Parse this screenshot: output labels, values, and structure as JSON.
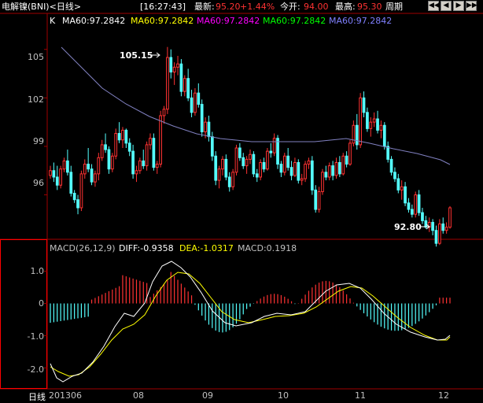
{
  "header": {
    "title": "电解镍(BNI)<日线>",
    "time": "[16:27:43]",
    "latest_label": "最新:",
    "latest_value": "95.20",
    "change": "+1.44%",
    "open_label": "今开:",
    "open_value": "94.00",
    "high_label": "最高:",
    "high_value": "95.30",
    "period_label": "周期"
  },
  "main_panel": {
    "k_label": "K",
    "ma_entries": [
      {
        "text": "MA60:97.2842",
        "color": "#ffffff"
      },
      {
        "text": "MA60:97.2842",
        "color": "#ffff00"
      },
      {
        "text": "MA60:97.2842",
        "color": "#ff00ff"
      },
      {
        "text": "MA60:97.2842",
        "color": "#00ff00"
      },
      {
        "text": "MA60:97.2842",
        "color": "#8080ff"
      }
    ],
    "y_ticks": [
      "105",
      "102",
      "99",
      "96"
    ],
    "annot_high": "105.15",
    "annot_low": "92.80"
  },
  "macd_panel": {
    "title": "MACD(26,12,9)",
    "diff": "DIFF:-0.9358",
    "dea": "DEA:-1.0317",
    "macd": "MACD:0.1918",
    "y_ticks": [
      "1.0",
      "0",
      "-1.0",
      "-2.0"
    ]
  },
  "x_axis": {
    "period": "日线",
    "labels": [
      "201306",
      "08",
      "09",
      "10",
      "11",
      "12"
    ]
  },
  "colors": {
    "up": "#ff3232",
    "down": "#54ffff",
    "ma": "#8080c0",
    "diff": "#ffffff",
    "dea": "#ffff00",
    "frame": "#a00000"
  },
  "chart_data": {
    "type": "candlestick",
    "ylim": [
      93.3,
      106.4
    ],
    "candles": [
      [
        97.2,
        97.8,
        97.0,
        97.5
      ],
      [
        97.5,
        98.0,
        96.8,
        97.1
      ],
      [
        97.1,
        97.8,
        96.3,
        96.6
      ],
      [
        96.6,
        97.8,
        96.4,
        97.6
      ],
      [
        97.6,
        98.3,
        97.4,
        98.1
      ],
      [
        98.1,
        98.8,
        97.2,
        97.4
      ],
      [
        97.4,
        97.8,
        95.9,
        96.1
      ],
      [
        96.1,
        96.3,
        95.5,
        95.7
      ],
      [
        95.7,
        96.0,
        94.8,
        95.2
      ],
      [
        95.2,
        97.5,
        95.0,
        97.3
      ],
      [
        97.3,
        98.2,
        97.0,
        97.9
      ],
      [
        97.9,
        98.9,
        97.4,
        97.6
      ],
      [
        97.6,
        97.9,
        96.6,
        96.8
      ],
      [
        96.8,
        97.5,
        96.5,
        97.3
      ],
      [
        97.3,
        98.6,
        96.9,
        98.3
      ],
      [
        98.3,
        99.4,
        98.1,
        99.1
      ],
      [
        99.1,
        99.8,
        98.6,
        98.8
      ],
      [
        98.8,
        99.0,
        97.3,
        97.6
      ],
      [
        97.6,
        98.6,
        97.4,
        98.4
      ],
      [
        98.4,
        100.1,
        98.2,
        99.8
      ],
      [
        99.8,
        100.5,
        99.2,
        99.4
      ],
      [
        99.4,
        100.2,
        98.9,
        100.0
      ],
      [
        100.0,
        100.1,
        98.9,
        99.2
      ],
      [
        99.2,
        99.5,
        98.4,
        98.7
      ],
      [
        98.7,
        99.1,
        97.0,
        97.3
      ],
      [
        97.3,
        97.8,
        96.8,
        97.5
      ],
      [
        97.5,
        98.3,
        97.3,
        98.1
      ],
      [
        98.1,
        98.8,
        97.6,
        97.8
      ],
      [
        97.8,
        99.3,
        97.5,
        99.1
      ],
      [
        99.1,
        99.8,
        98.8,
        99.5
      ],
      [
        99.5,
        99.8,
        97.5,
        97.7
      ],
      [
        97.7,
        98.1,
        97.3,
        97.9
      ],
      [
        97.9,
        101.2,
        97.7,
        100.9
      ],
      [
        100.9,
        101.5,
        100.4,
        101.3
      ],
      [
        101.3,
        105.15,
        101.0,
        104.5
      ],
      [
        104.5,
        105.0,
        103.2,
        103.6
      ],
      [
        103.6,
        104.2,
        102.8,
        103.9
      ],
      [
        103.9,
        104.6,
        103.4,
        104.1
      ],
      [
        104.1,
        104.4,
        102.1,
        102.4
      ],
      [
        102.4,
        103.4,
        102.1,
        103.2
      ],
      [
        103.2,
        103.8,
        101.8,
        102.0
      ],
      [
        102.0,
        102.5,
        100.8,
        101.1
      ],
      [
        101.1,
        102.6,
        100.9,
        102.3
      ],
      [
        102.3,
        102.9,
        101.4,
        101.6
      ],
      [
        101.6,
        101.9,
        99.6,
        99.9
      ],
      [
        99.9,
        100.8,
        99.5,
        100.5
      ],
      [
        100.5,
        100.9,
        99.3,
        99.6
      ],
      [
        99.6,
        99.9,
        98.1,
        98.4
      ],
      [
        98.4,
        98.7,
        96.6,
        96.9
      ],
      [
        96.9,
        97.8,
        96.4,
        97.6
      ],
      [
        97.6,
        98.4,
        97.2,
        98.2
      ],
      [
        98.2,
        98.5,
        96.9,
        97.1
      ],
      [
        97.1,
        97.4,
        96.2,
        96.5
      ],
      [
        96.5,
        97.6,
        96.3,
        97.4
      ],
      [
        97.4,
        99.1,
        97.2,
        98.9
      ],
      [
        98.9,
        99.2,
        98.1,
        98.3
      ],
      [
        98.3,
        98.6,
        97.6,
        97.8
      ],
      [
        97.8,
        98.4,
        97.3,
        98.2
      ],
      [
        98.2,
        98.8,
        97.9,
        98.5
      ],
      [
        98.5,
        98.7,
        97.1,
        97.3
      ],
      [
        97.3,
        97.6,
        96.8,
        97.1
      ],
      [
        97.1,
        98.2,
        96.9,
        98.0
      ],
      [
        98.0,
        98.3,
        97.4,
        97.6
      ],
      [
        97.6,
        98.9,
        97.5,
        98.7
      ],
      [
        98.7,
        99.2,
        98.3,
        98.6
      ],
      [
        98.6,
        99.8,
        98.4,
        99.5
      ],
      [
        99.5,
        99.7,
        97.6,
        97.9
      ],
      [
        97.9,
        98.1,
        97.1,
        97.4
      ],
      [
        97.4,
        98.6,
        97.2,
        98.4
      ],
      [
        98.4,
        98.9,
        97.5,
        97.7
      ],
      [
        97.7,
        98.1,
        96.9,
        97.2
      ],
      [
        97.2,
        98.3,
        97.1,
        98.0
      ],
      [
        98.0,
        98.2,
        96.7,
        96.9
      ],
      [
        96.9,
        97.3,
        96.6,
        97.0
      ],
      [
        97.0,
        98.1,
        96.8,
        97.9
      ],
      [
        97.9,
        98.3,
        97.6,
        98.1
      ],
      [
        98.1,
        98.4,
        96.0,
        96.3
      ],
      [
        96.3,
        96.6,
        94.9,
        95.1
      ],
      [
        95.1,
        96.5,
        94.9,
        96.2
      ],
      [
        96.2,
        97.6,
        96.0,
        97.4
      ],
      [
        97.4,
        97.8,
        96.9,
        97.1
      ],
      [
        97.1,
        98.0,
        96.9,
        97.8
      ],
      [
        97.8,
        98.1,
        96.9,
        97.2
      ],
      [
        97.2,
        98.3,
        97.0,
        98.0
      ],
      [
        98.0,
        98.4,
        97.1,
        97.3
      ],
      [
        97.3,
        98.6,
        97.2,
        98.4
      ],
      [
        98.4,
        98.7,
        97.7,
        97.9
      ],
      [
        97.9,
        99.4,
        97.8,
        99.2
      ],
      [
        99.2,
        100.6,
        99.0,
        100.3
      ],
      [
        100.3,
        101.0,
        98.8,
        99.1
      ],
      [
        99.1,
        102.3,
        98.9,
        102.0
      ],
      [
        102.0,
        102.4,
        100.8,
        101.1
      ],
      [
        101.1,
        101.4,
        99.9,
        100.1
      ],
      [
        100.1,
        100.8,
        99.6,
        100.5
      ],
      [
        100.5,
        101.1,
        100.2,
        100.7
      ],
      [
        100.7,
        101.2,
        99.8,
        100.0
      ],
      [
        100.0,
        100.6,
        99.5,
        100.3
      ],
      [
        100.3,
        100.5,
        98.8,
        99.0
      ],
      [
        99.0,
        99.3,
        98.0,
        98.2
      ],
      [
        98.2,
        98.4,
        97.2,
        97.4
      ],
      [
        97.4,
        97.7,
        96.8,
        97.0
      ],
      [
        97.0,
        97.3,
        96.1,
        96.3
      ],
      [
        96.3,
        96.9,
        95.7,
        96.5
      ],
      [
        96.5,
        96.8,
        95.3,
        95.5
      ],
      [
        95.5,
        95.8,
        94.9,
        95.1
      ],
      [
        95.1,
        95.4,
        94.6,
        94.8
      ],
      [
        94.8,
        96.2,
        94.6,
        96.0
      ],
      [
        96.0,
        96.3,
        94.7,
        94.9
      ],
      [
        94.9,
        95.2,
        94.2,
        94.4
      ],
      [
        94.4,
        94.7,
        93.9,
        94.0
      ],
      [
        94.0,
        94.6,
        93.7,
        94.3
      ],
      [
        94.3,
        94.5,
        93.5,
        93.8
      ],
      [
        93.8,
        94.1,
        92.8,
        93.0
      ],
      [
        93.0,
        94.5,
        92.9,
        94.2
      ],
      [
        94.2,
        94.6,
        93.6,
        93.8
      ],
      [
        93.8,
        94.3,
        93.6,
        94.0
      ],
      [
        94.0,
        95.3,
        93.9,
        95.2
      ]
    ],
    "ma60": [
      101.2,
      101.1,
      101.0,
      100.9,
      100.8,
      100.7,
      100.6,
      100.5,
      100.4,
      100.3
    ],
    "macd_ylim": [
      -2.6,
      1.6
    ]
  }
}
